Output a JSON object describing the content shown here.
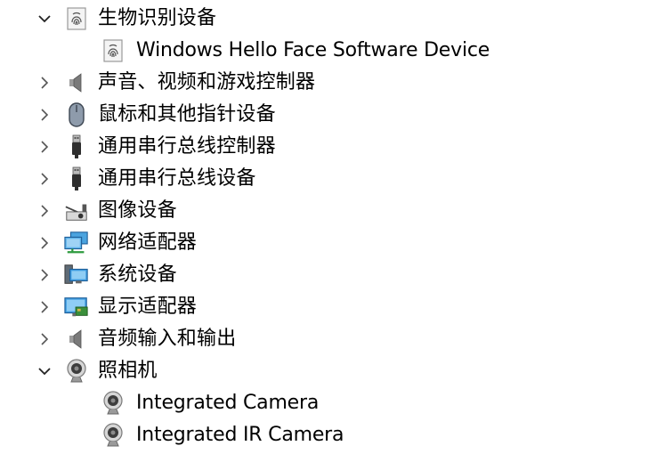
{
  "tree": {
    "items": [
      {
        "label": "生物识别设备",
        "icon": "fingerprint-icon",
        "expanded": true,
        "level": 0
      },
      {
        "label": "Windows Hello Face Software Device",
        "icon": "fingerprint-icon",
        "level": 1
      },
      {
        "label": "声音、视频和游戏控制器",
        "icon": "speaker-icon",
        "expanded": false,
        "level": 0
      },
      {
        "label": "鼠标和其他指针设备",
        "icon": "mouse-icon",
        "expanded": false,
        "level": 0
      },
      {
        "label": "通用串行总线控制器",
        "icon": "usb-icon",
        "expanded": false,
        "level": 0
      },
      {
        "label": "通用串行总线设备",
        "icon": "usb-icon",
        "expanded": false,
        "level": 0
      },
      {
        "label": "图像设备",
        "icon": "camera-device-icon",
        "expanded": false,
        "level": 0
      },
      {
        "label": "网络适配器",
        "icon": "network-adapter-icon",
        "expanded": false,
        "level": 0
      },
      {
        "label": "系统设备",
        "icon": "system-device-icon",
        "expanded": false,
        "level": 0
      },
      {
        "label": "显示适配器",
        "icon": "display-adapter-icon",
        "expanded": false,
        "level": 0
      },
      {
        "label": "音频输入和输出",
        "icon": "speaker-icon",
        "expanded": false,
        "level": 0
      },
      {
        "label": "照相机",
        "icon": "webcam-icon",
        "expanded": true,
        "level": 0
      },
      {
        "label": "Integrated Camera",
        "icon": "webcam-icon",
        "level": 1
      },
      {
        "label": "Integrated IR Camera",
        "icon": "webcam-icon",
        "level": 1
      }
    ]
  }
}
